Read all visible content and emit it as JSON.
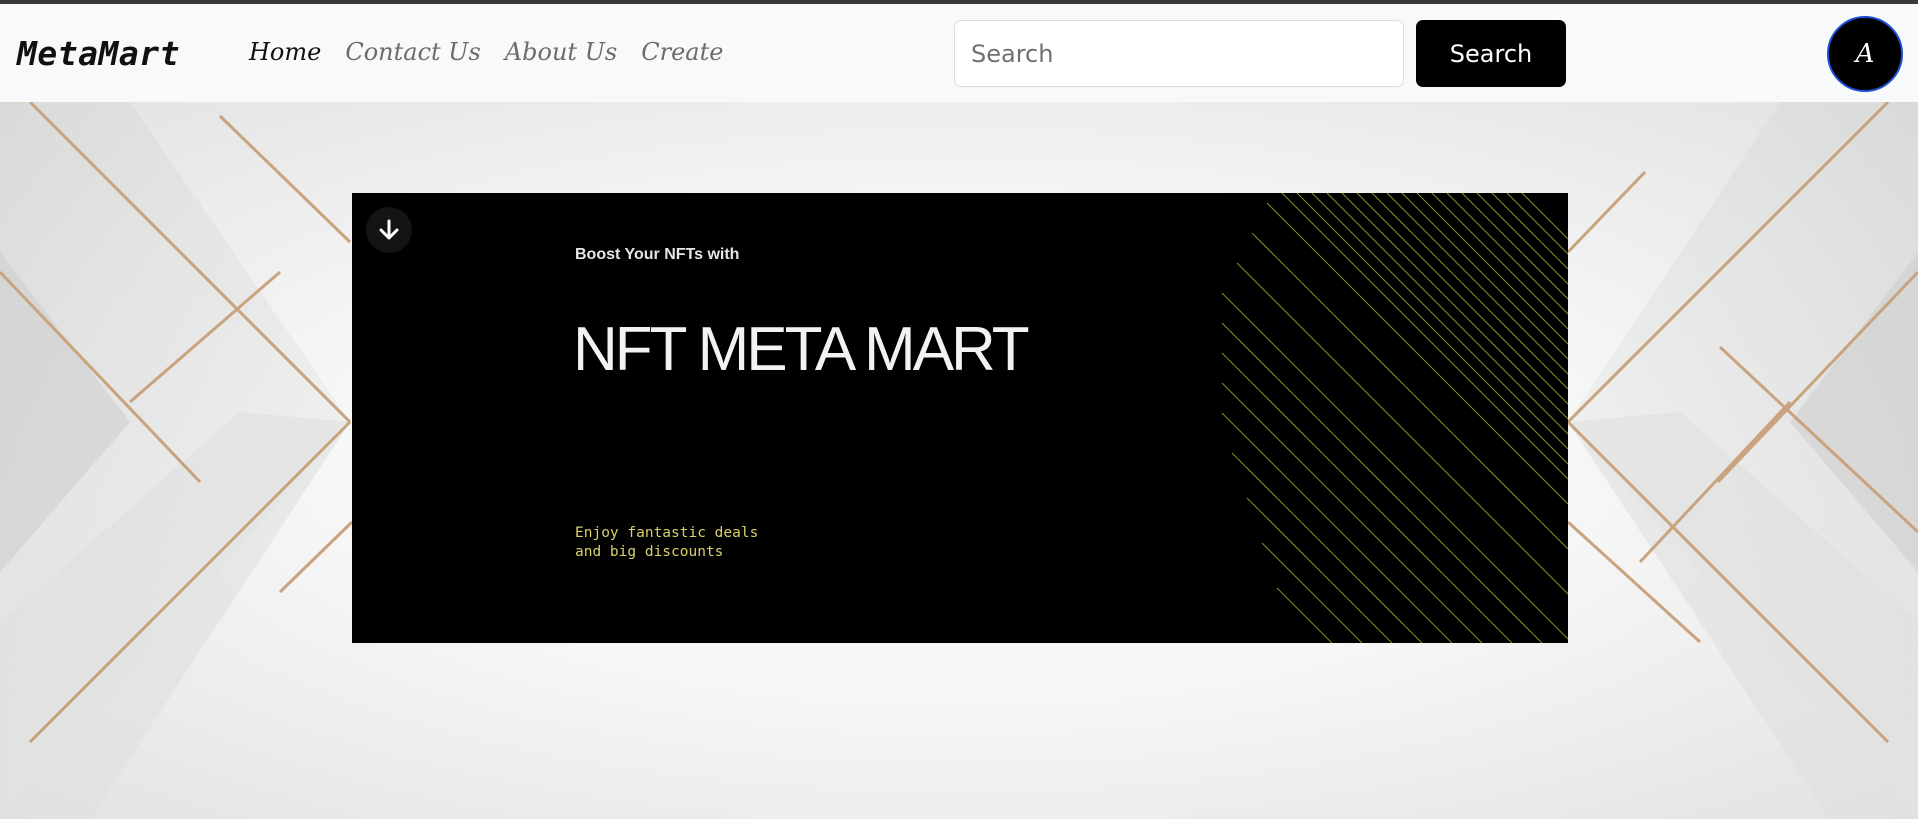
{
  "navbar": {
    "brand": "MetaMart",
    "links": [
      {
        "label": "Home",
        "active": true
      },
      {
        "label": "Contact Us",
        "active": false
      },
      {
        "label": "About Us",
        "active": false
      },
      {
        "label": "Create",
        "active": false
      }
    ],
    "search": {
      "placeholder": "Search",
      "value": ""
    },
    "search_button": "Search",
    "avatar_initial": "A"
  },
  "banner": {
    "tagline": "Boost Your NFTs with",
    "headline": "NFT META MART",
    "deals_line1": "Enjoy fantastic deals",
    "deals_line2": "and big discounts",
    "scroll_icon": "arrow-down-icon"
  },
  "colors": {
    "nav_bg": "#f8f9fa",
    "button_bg": "#000000",
    "avatar_border": "#1c4fd6",
    "deals_text": "#d9d06a",
    "banner_lines": "#a6a62a"
  }
}
